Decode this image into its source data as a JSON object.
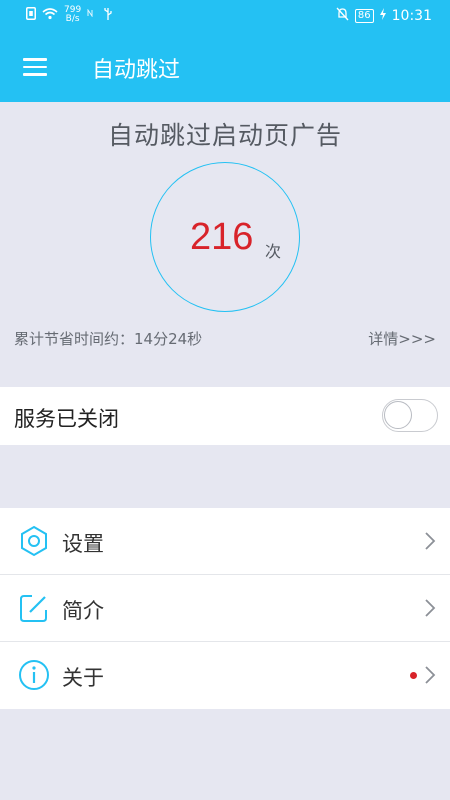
{
  "status_bar": {
    "net_speed_value": "799",
    "net_speed_unit": "B/s",
    "battery": "86",
    "time": "10:31"
  },
  "app_bar": {
    "title": "自动跳过"
  },
  "stats": {
    "heading": "自动跳过启动页广告",
    "count": "216",
    "count_unit": "次",
    "saved_time": "累计节省时间约：14分24秒",
    "details_link": "详情>>>"
  },
  "service": {
    "label": "服务已关闭",
    "enabled": false
  },
  "menu": {
    "items": [
      {
        "label": "设置",
        "icon": "hexagon-settings-icon"
      },
      {
        "label": "简介",
        "icon": "edit-icon"
      },
      {
        "label": "关于",
        "icon": "info-icon",
        "badge": true
      }
    ]
  },
  "colors": {
    "primary": "#24c1f3",
    "accent_red": "#d8232a",
    "background": "#e6e7f1"
  }
}
